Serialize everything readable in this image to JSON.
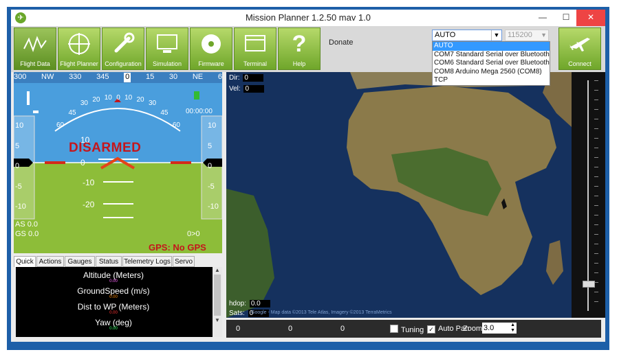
{
  "window": {
    "title": "Mission Planner 1.2.50 mav 1.0"
  },
  "toolbar": {
    "buttons": [
      {
        "label": "Flight Data"
      },
      {
        "label": "Flight Planner"
      },
      {
        "label": "Configuration"
      },
      {
        "label": "Simulation"
      },
      {
        "label": "Firmware"
      },
      {
        "label": "Terminal"
      },
      {
        "label": "Help"
      }
    ],
    "donate": "Donate",
    "connect": "Connect"
  },
  "port": {
    "selected": "AUTO",
    "options": [
      "AUTO",
      "COM7 Standard Serial over Bluetooth",
      "COM6 Standard Serial over Bluetooth",
      "COM8 Arduino Mega 2560 (COM8)",
      "TCP"
    ]
  },
  "baud": {
    "selected": "115200"
  },
  "hud": {
    "heading_ticks": [
      "300",
      "NW",
      "330",
      "345",
      "0",
      "15",
      "30",
      "NE",
      "6"
    ],
    "roll_labels": [
      "60",
      "45",
      "30",
      "20",
      "10",
      "0",
      "10",
      "20",
      "30",
      "45",
      "60"
    ],
    "pitch_labels": [
      "10",
      "0",
      "-10",
      "-20"
    ],
    "left_scale": [
      "10",
      "5",
      "0",
      "-5",
      "-10"
    ],
    "right_scale": [
      "10",
      "5",
      "0",
      "-5",
      "-10"
    ],
    "status": "DISARMED",
    "airspeed": "AS 0.0",
    "groundspeed": "GS 0.0",
    "wp": "0>0",
    "gps": "GPS: No GPS",
    "time": "00:00:00",
    "colors": {
      "sky": "#4a9edd",
      "ground": "#8dbd39",
      "warn": "#c4161c"
    }
  },
  "tabs": [
    "Quick",
    "Actions",
    "Gauges",
    "Status",
    "Telemetry Logs",
    "Servo"
  ],
  "quick": [
    {
      "label": "Altitude (Meters)",
      "value": "0.00",
      "color": "#ff66ff"
    },
    {
      "label": "GroundSpeed (m/s)",
      "value": "0.00",
      "color": "#ff8800"
    },
    {
      "label": "Dist to WP (Meters)",
      "value": "0.00",
      "color": "#ff3333"
    },
    {
      "label": "Yaw (deg)",
      "value": "0.00",
      "color": "#33ff66"
    }
  ],
  "map": {
    "dir_label": "Dir:",
    "dir_value": "0",
    "vel_label": "Vel:",
    "vel_value": "0",
    "hdop_label": "hdop:",
    "hdop_value": "0.0",
    "sats_label": "Sats:",
    "sats_value": "0",
    "copyright": "Google - Map data ©2013 Tele Atlas, Imagery ©2013 TerraMetrics"
  },
  "statusbar": {
    "v1": "0",
    "v2": "0",
    "v3": "0",
    "tuning": "Tuning",
    "autopan": "Auto Pan",
    "zoom_label": "Zoom",
    "zoom_value": "3.0"
  }
}
